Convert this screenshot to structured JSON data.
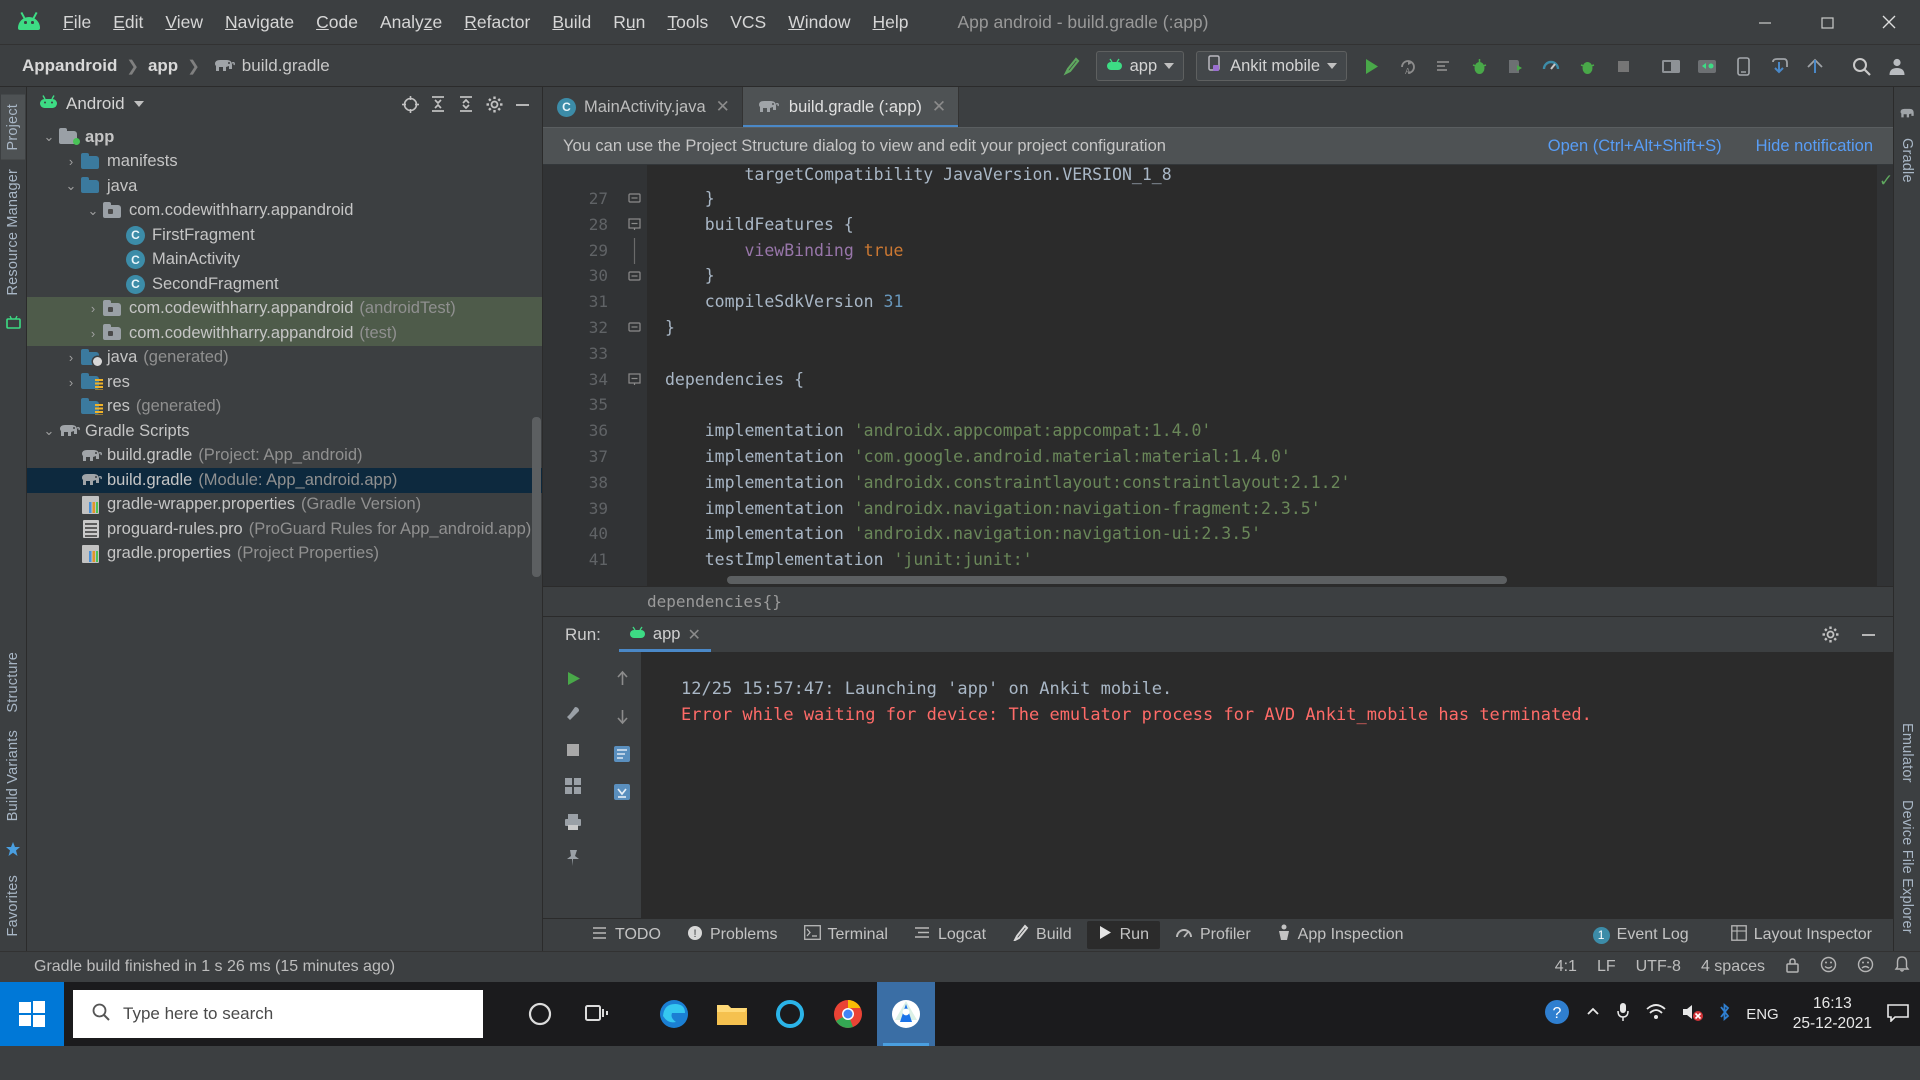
{
  "menubar": {
    "items": [
      "File",
      "Edit",
      "View",
      "Navigate",
      "Code",
      "Analyze",
      "Refactor",
      "Build",
      "Run",
      "Tools",
      "VCS",
      "Window",
      "Help"
    ],
    "window_title": "App android - build.gradle (:app)"
  },
  "navbar": {
    "breadcrumbs": [
      "Appandroid",
      "app",
      "build.gradle"
    ],
    "module_selector": "app",
    "device_selector": "Ankit mobile"
  },
  "project_panel": {
    "view_name": "Android",
    "tree": [
      {
        "indent": 0,
        "arrow": "v",
        "icon": "module-folder",
        "label": "app",
        "bold": true,
        "sub": "",
        "state": "normal"
      },
      {
        "indent": 1,
        "arrow": ">",
        "icon": "folder-blue",
        "label": "manifests",
        "bold": false,
        "sub": "",
        "state": "normal"
      },
      {
        "indent": 1,
        "arrow": "v",
        "icon": "folder-blue",
        "label": "java",
        "bold": false,
        "sub": "",
        "state": "normal"
      },
      {
        "indent": 2,
        "arrow": "v",
        "icon": "package",
        "label": "com.codewithharry.appandroid",
        "bold": false,
        "sub": "",
        "state": "normal"
      },
      {
        "indent": 3,
        "arrow": "",
        "icon": "class",
        "label": "FirstFragment",
        "bold": false,
        "sub": "",
        "state": "normal"
      },
      {
        "indent": 3,
        "arrow": "",
        "icon": "class",
        "label": "MainActivity",
        "bold": false,
        "sub": "",
        "state": "normal"
      },
      {
        "indent": 3,
        "arrow": "",
        "icon": "class",
        "label": "SecondFragment",
        "bold": false,
        "sub": "",
        "state": "normal"
      },
      {
        "indent": 2,
        "arrow": ">",
        "icon": "package",
        "label": "com.codewithharry.appandroid",
        "bold": false,
        "sub": "(androidTest)",
        "state": "test"
      },
      {
        "indent": 2,
        "arrow": ">",
        "icon": "package",
        "label": "com.codewithharry.appandroid",
        "bold": false,
        "sub": "(test)",
        "state": "test"
      },
      {
        "indent": 1,
        "arrow": ">",
        "icon": "folder-generated",
        "label": "java",
        "bold": false,
        "sub": "(generated)",
        "state": "normal"
      },
      {
        "indent": 1,
        "arrow": ">",
        "icon": "folder-res",
        "label": "res",
        "bold": false,
        "sub": "",
        "state": "normal"
      },
      {
        "indent": 1,
        "arrow": "",
        "icon": "folder-res",
        "label": "res",
        "bold": false,
        "sub": "(generated)",
        "state": "normal"
      },
      {
        "indent": 0,
        "arrow": "v",
        "icon": "gradle",
        "label": "Gradle Scripts",
        "bold": false,
        "sub": "",
        "state": "normal"
      },
      {
        "indent": 1,
        "arrow": "",
        "icon": "gradle",
        "label": "build.gradle",
        "bold": false,
        "sub": "(Project: App_android)",
        "state": "normal"
      },
      {
        "indent": 1,
        "arrow": "",
        "icon": "gradle",
        "label": "build.gradle",
        "bold": false,
        "sub": "(Module: App_android.app)",
        "state": "selected"
      },
      {
        "indent": 1,
        "arrow": "",
        "icon": "properties",
        "label": "gradle-wrapper.properties",
        "bold": false,
        "sub": "(Gradle Version)",
        "state": "normal"
      },
      {
        "indent": 1,
        "arrow": "",
        "icon": "text-file",
        "label": "proguard-rules.pro",
        "bold": false,
        "sub": "(ProGuard Rules for App_android.app)",
        "state": "normal"
      },
      {
        "indent": 1,
        "arrow": "",
        "icon": "properties",
        "label": "gradle.properties",
        "bold": false,
        "sub": "(Project Properties)",
        "state": "normal"
      }
    ]
  },
  "left_stripe": {
    "items": [
      "Project",
      "Resource Manager"
    ],
    "bottom_items": [
      "Favorites",
      "Build Variants",
      "Structure"
    ]
  },
  "right_stripe": {
    "items": [
      "Gradle",
      "Device File Explorer",
      "Emulator"
    ]
  },
  "editor": {
    "tabs": [
      {
        "label": "MainActivity.java",
        "icon": "class",
        "active": false
      },
      {
        "label": "build.gradle (:app)",
        "icon": "gradle",
        "active": true
      }
    ],
    "notification": {
      "text": "You can use the Project Structure dialog to view and edit your project configuration",
      "open_link": "Open (Ctrl+Alt+Shift+S)",
      "hide_link": "Hide notification"
    },
    "breadcrumb": "dependencies{}",
    "lines": [
      {
        "num": "27",
        "fold": "collapse-end",
        "segments": [
          {
            "t": "    }",
            "c": "fn"
          }
        ]
      },
      {
        "num": "28",
        "fold": "collapse",
        "segments": [
          {
            "t": "    buildFeatures {",
            "c": "fn"
          }
        ]
      },
      {
        "num": "29",
        "fold": "bar",
        "segments": [
          {
            "t": "        ",
            "c": "fn"
          },
          {
            "t": "viewBinding",
            "c": "prop"
          },
          {
            "t": " ",
            "c": "fn"
          },
          {
            "t": "true",
            "c": "kw"
          }
        ]
      },
      {
        "num": "30",
        "fold": "collapse-end",
        "segments": [
          {
            "t": "    }",
            "c": "fn"
          }
        ]
      },
      {
        "num": "31",
        "fold": "",
        "segments": [
          {
            "t": "    compileSdkVersion ",
            "c": "fn"
          },
          {
            "t": "31",
            "c": "num"
          }
        ]
      },
      {
        "num": "32",
        "fold": "collapse-end",
        "segments": [
          {
            "t": "}",
            "c": "fn"
          }
        ]
      },
      {
        "num": "33",
        "fold": "",
        "segments": [
          {
            "t": "",
            "c": "fn"
          }
        ]
      },
      {
        "num": "34",
        "fold": "collapse",
        "segments": [
          {
            "t": "dependencies {",
            "c": "fn"
          }
        ]
      },
      {
        "num": "35",
        "fold": "",
        "segments": [
          {
            "t": "",
            "c": "fn"
          }
        ]
      },
      {
        "num": "36",
        "fold": "",
        "segments": [
          {
            "t": "    implementation ",
            "c": "fn"
          },
          {
            "t": "'androidx.appcompat:appcompat:1.4.0'",
            "c": "str"
          }
        ]
      },
      {
        "num": "37",
        "fold": "",
        "segments": [
          {
            "t": "    implementation ",
            "c": "fn"
          },
          {
            "t": "'com.google.android.material:material:1.4.0'",
            "c": "str"
          }
        ]
      },
      {
        "num": "38",
        "fold": "",
        "segments": [
          {
            "t": "    implementation ",
            "c": "fn"
          },
          {
            "t": "'androidx.constraintlayout:constraintlayout:2.1.2'",
            "c": "str"
          }
        ]
      },
      {
        "num": "39",
        "fold": "",
        "segments": [
          {
            "t": "    implementation ",
            "c": "fn"
          },
          {
            "t": "'androidx.navigation:navigation-fragment:2.3.5'",
            "c": "str"
          }
        ]
      },
      {
        "num": "40",
        "fold": "",
        "segments": [
          {
            "t": "    implementation ",
            "c": "fn"
          },
          {
            "t": "'androidx.navigation:navigation-ui:2.3.5'",
            "c": "str"
          }
        ]
      },
      {
        "num": "41",
        "fold": "",
        "segments": [
          {
            "t": "    testImplementation ",
            "c": "fn"
          },
          {
            "t": "'junit:junit:'",
            "c": "str"
          }
        ]
      }
    ]
  },
  "run_panel": {
    "label": "Run:",
    "tab": "app",
    "console": [
      {
        "text": "12/25 15:57:47: Launching 'app' on Ankit mobile.",
        "error": false
      },
      {
        "text": "Error while waiting for device: The emulator process for AVD Ankit_mobile has terminated.",
        "error": true
      }
    ]
  },
  "toolwindow_bar": {
    "items": [
      {
        "label": "TODO",
        "icon": "todo-icon",
        "sel": false
      },
      {
        "label": "Problems",
        "icon": "problems-icon",
        "sel": false
      },
      {
        "label": "Terminal",
        "icon": "terminal-icon",
        "sel": false
      },
      {
        "label": "Logcat",
        "icon": "logcat-icon",
        "sel": false
      },
      {
        "label": "Build",
        "icon": "build-icon",
        "sel": false
      },
      {
        "label": "Run",
        "icon": "run-icon",
        "sel": true
      },
      {
        "label": "Profiler",
        "icon": "profiler-icon",
        "sel": false
      },
      {
        "label": "App Inspection",
        "icon": "app-inspection-icon",
        "sel": false
      }
    ],
    "event_log": "Event Log",
    "event_log_count": "1",
    "layout_inspector": "Layout Inspector"
  },
  "statusbar": {
    "message": "Gradle build finished in 1 s 26 ms (15 minutes ago)",
    "caret": "4:1",
    "line_sep": "LF",
    "encoding": "UTF-8",
    "indent": "4 spaces"
  },
  "taskbar": {
    "search_placeholder": "Type here to search",
    "language": "ENG",
    "clock_time": "16:13",
    "clock_date": "25-12-2021"
  },
  "colors": {
    "accent_blue": "#4a88c7",
    "android_green": "#3ddc84",
    "error_red": "#ff6b68",
    "string_green": "#6a8759",
    "keyword_orange": "#cc7832",
    "number_blue": "#6897bb",
    "selection_blue": "#0d293e",
    "test_green": "#4e5b4a"
  }
}
